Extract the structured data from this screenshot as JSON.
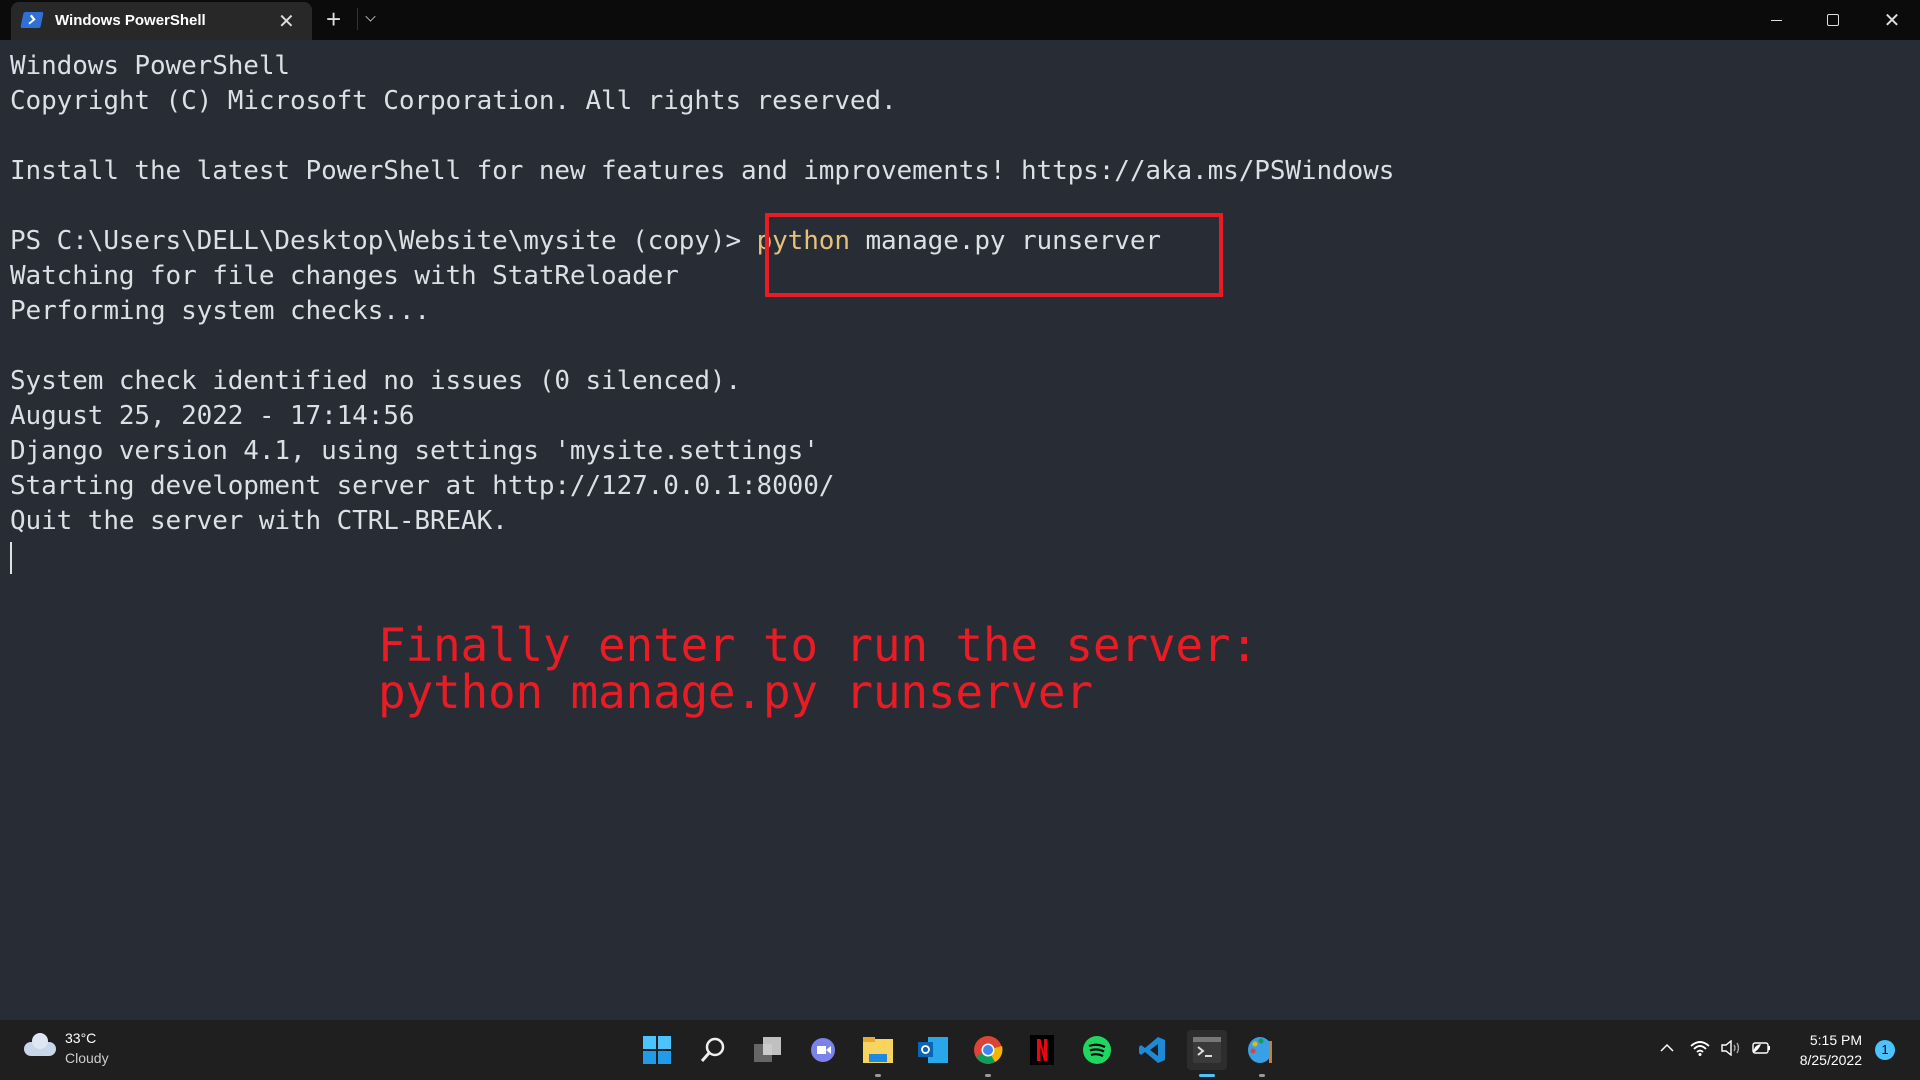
{
  "window": {
    "tab_title": "Windows PowerShell",
    "tab_icon": "powershell-icon"
  },
  "terminal": {
    "lines": [
      "Windows PowerShell",
      "Copyright (C) Microsoft Corporation. All rights reserved.",
      "",
      "Install the latest PowerShell for new features and improvements! https://aka.ms/PSWindows",
      "",
      "",
      "Watching for file changes with StatReloader",
      "Performing system checks...",
      "",
      "System check identified no issues (0 silenced).",
      "August 25, 2022 - 17:14:56",
      "Django version 4.1, using settings 'mysite.settings'",
      "Starting development server at http://127.0.0.1:8000/",
      "Quit the server with CTRL-BREAK."
    ],
    "prompt": "PS C:\\Users\\DELL\\Desktop\\Website\\mysite (copy)> ",
    "command_keyword": "python",
    "command_args": " manage.py runserver"
  },
  "annotation": {
    "line1": "Finally enter to run the server:",
    "line2": "python manage.py runserver",
    "color": "#e81c24"
  },
  "taskbar": {
    "weather": {
      "temp": "33°C",
      "condition": "Cloudy"
    },
    "apps": [
      "start",
      "search",
      "task-view",
      "teams-chat",
      "file-explorer",
      "outlook",
      "chrome",
      "netflix",
      "spotify",
      "vscode",
      "terminal",
      "paint"
    ],
    "clock": {
      "time": "5:15 PM",
      "date": "8/25/2022"
    },
    "notification_count": "1"
  }
}
